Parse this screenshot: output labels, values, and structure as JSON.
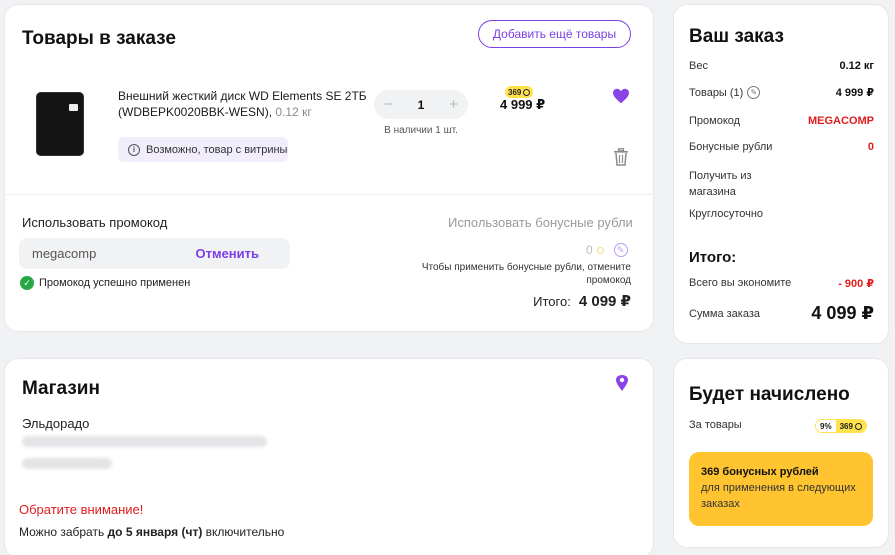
{
  "goods": {
    "title": "Товары в заказе",
    "add_more_label": "Добавить ещё товары",
    "item": {
      "name": "Внешний жесткий диск WD Elements SE 2ТБ (WDBEPK0020BBK-WESN),",
      "weight": " 0.12 кг",
      "vitrine_note": "Возможно, товар с витрины",
      "quantity": "1",
      "minus": "−",
      "plus": "+",
      "stock": "В наличии 1 шт.",
      "bonus": "369",
      "price": "4 999 ₽"
    },
    "promo": {
      "label": "Использовать промокод",
      "value": "megacomp",
      "cancel_label": "Отменить",
      "success": "Промокод успешно применен"
    },
    "bonus_rubles": {
      "label": "Использовать бонусные рубли",
      "value": "0",
      "hint": "Чтобы применить бонусные рубли, отмените промокод"
    },
    "total": {
      "label": "Итого:",
      "value": "4 099 ₽"
    }
  },
  "shop": {
    "title": "Магазин",
    "name": "Эльдорадо",
    "warning": "Обратите внимание!",
    "pickup_prefix": "Можно забрать ",
    "pickup_date": "до 5 января (чт)",
    "pickup_suffix": " включительно"
  },
  "order": {
    "title": "Ваш заказ",
    "weight_label": "Вес",
    "weight_value": "0.12 кг",
    "goods_label": "Товары (1)",
    "goods_value": "4 999 ₽",
    "promo_label": "Промокод",
    "promo_value": "MEGACOMP",
    "bonus_label": "Бонусные рубли",
    "bonus_value": "0",
    "delivery_label": "Получить из магазина",
    "delivery_value": "Круглосуточно",
    "total_title": "Итого:",
    "save_label": "Всего вы экономите",
    "save_value": "- 900 ₽",
    "sum_label": "Сумма заказа",
    "sum_value": "4 099 ₽"
  },
  "accrual": {
    "title": "Будет начислено",
    "for_goods_label": "За товары",
    "percent": "9%",
    "points": "369",
    "box_title": "369 бонусных рублей",
    "box_text": "для применения в следующих заказах"
  },
  "colors": {
    "accent": "#7b3fe4",
    "danger": "#e01d1d",
    "bonus": "#ffe24d",
    "orange": "#ffc430",
    "success": "#27a844"
  }
}
